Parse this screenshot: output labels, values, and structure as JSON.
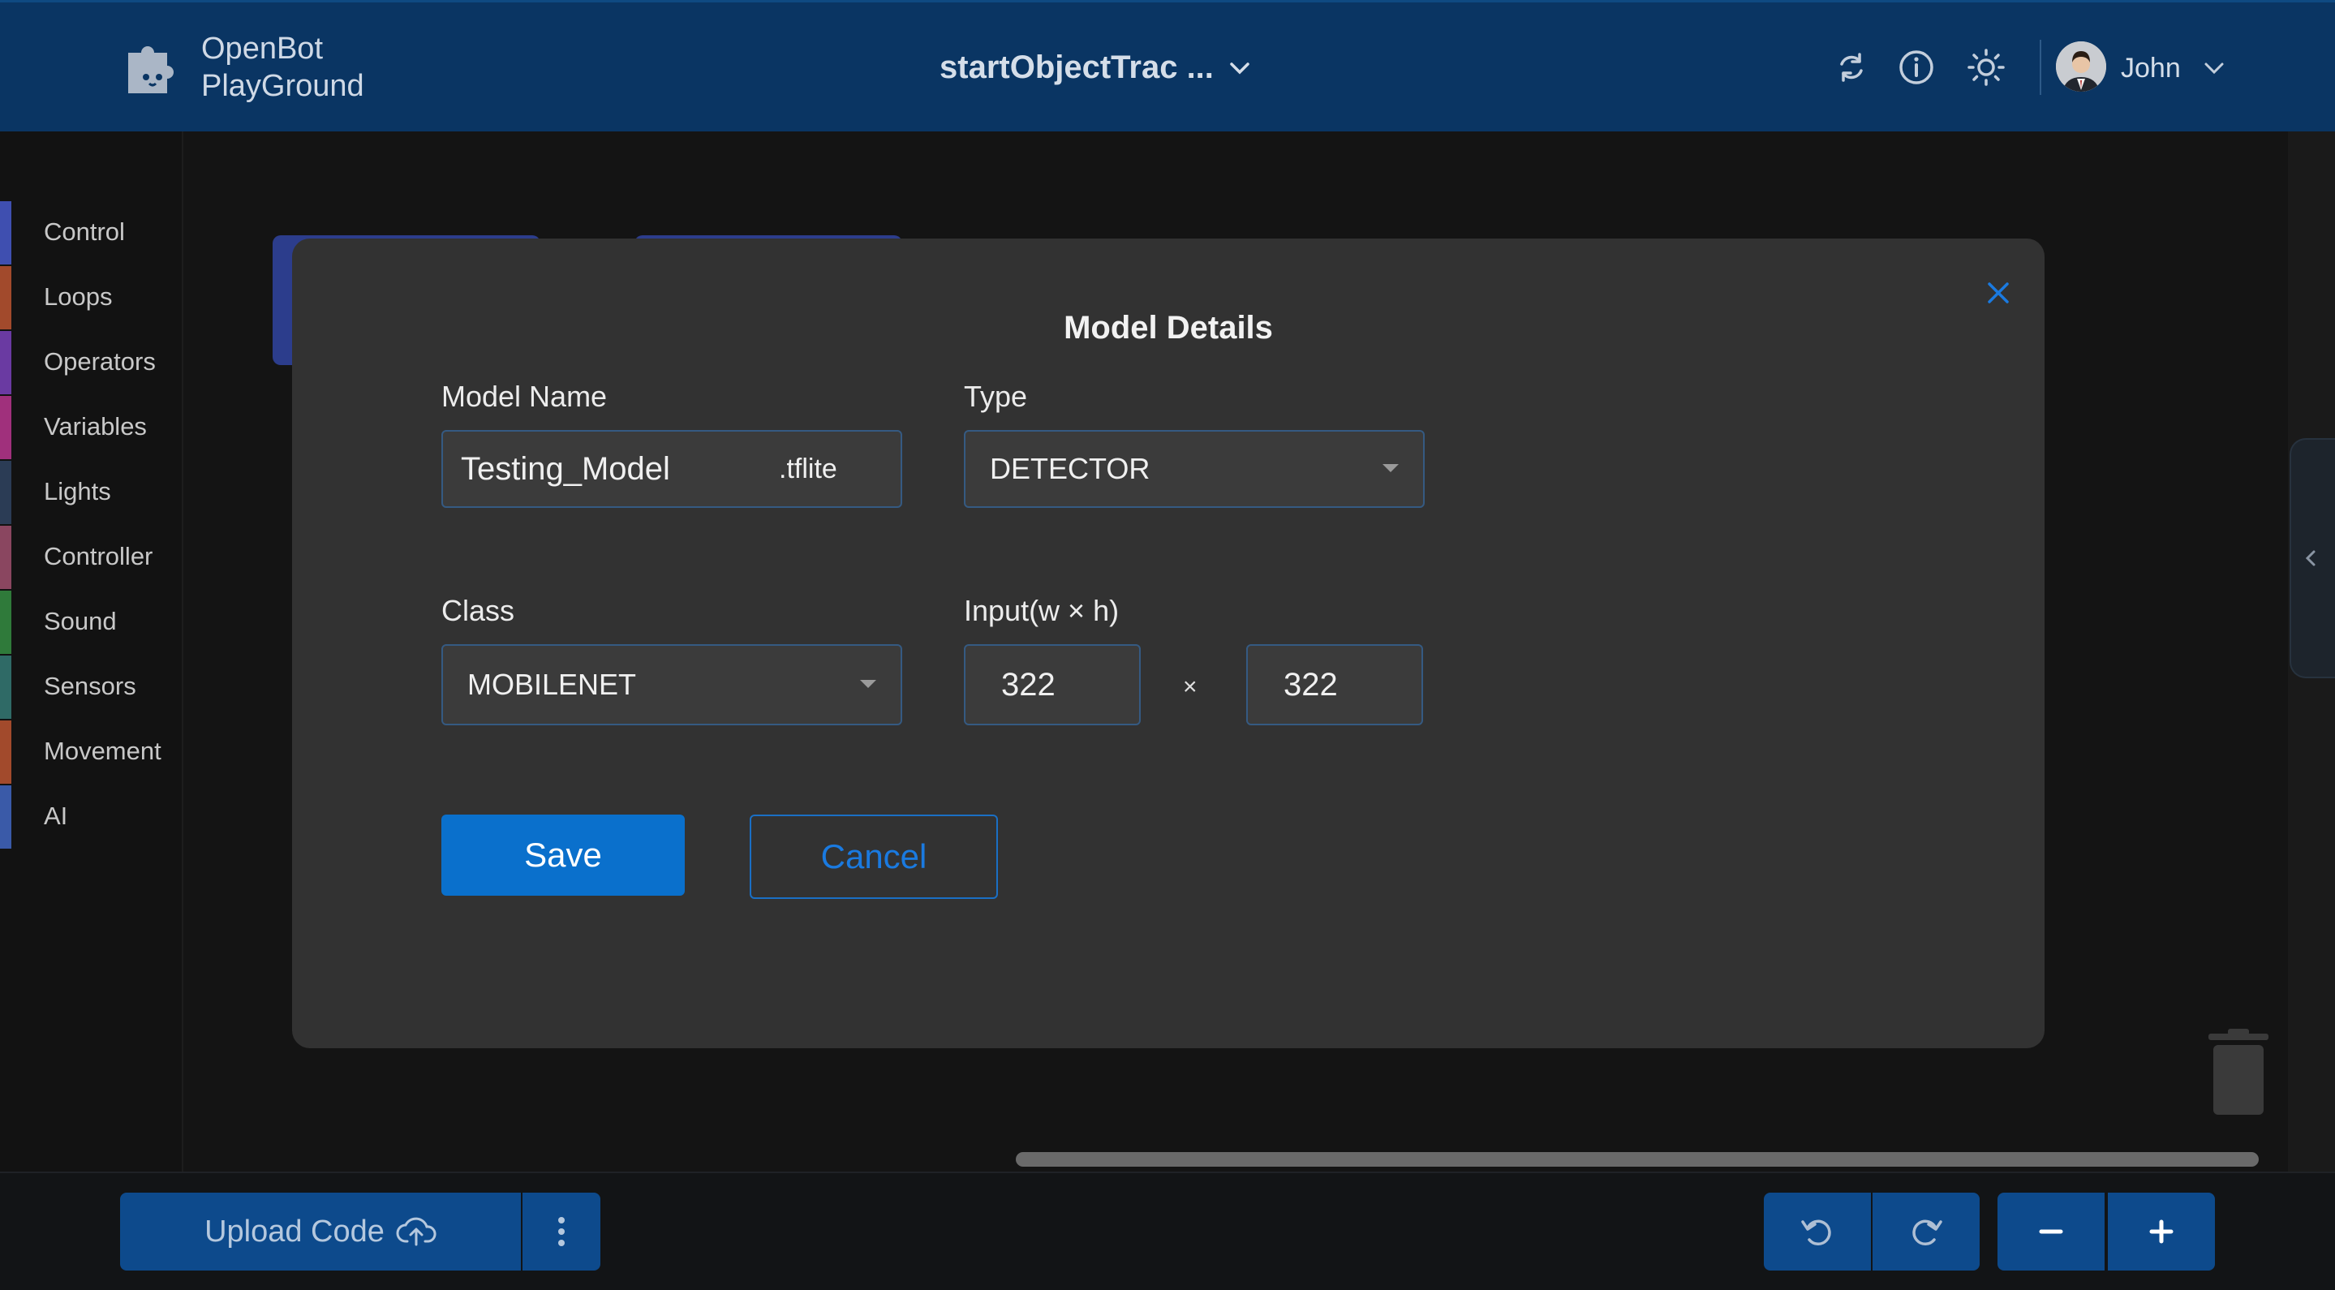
{
  "header": {
    "brand_line1": "OpenBot",
    "brand_line2": "PlayGround",
    "project_name": "startObjectTrac ...",
    "user_name": "John",
    "icons": [
      "puzzle-logo-icon",
      "sync-icon",
      "info-icon",
      "sun-icon",
      "user-avatar",
      "chevron-down-icon"
    ]
  },
  "sidebar": {
    "categories": [
      {
        "label": "Control",
        "color": "#3f4fb0"
      },
      {
        "label": "Loops",
        "color": "#a24a2c"
      },
      {
        "label": "Operators",
        "color": "#6a3aa2"
      },
      {
        "label": "Variables",
        "color": "#a0307c"
      },
      {
        "label": "Lights",
        "color": "#2b3c55"
      },
      {
        "label": "Controller",
        "color": "#8a4660"
      },
      {
        "label": "Sound",
        "color": "#2f7a3a"
      },
      {
        "label": "Sensors",
        "color": "#2f6a66"
      },
      {
        "label": "Movement",
        "color": "#a24a2c"
      },
      {
        "label": "AI",
        "color": "#3a5aa8"
      }
    ]
  },
  "modal": {
    "title": "Model Details",
    "model_name_label": "Model Name",
    "model_name_value": "Testing_Model",
    "model_name_suffix": ".tflite",
    "type_label": "Type",
    "type_value": "DETECTOR",
    "class_label": "Class",
    "class_value": "MOBILENET",
    "input_label": "Input(w × h)",
    "input_width": "322",
    "input_height": "322",
    "times_sign": "×",
    "save_label": "Save",
    "cancel_label": "Cancel"
  },
  "bottom_bar": {
    "upload_label": "Upload Code",
    "icons": [
      "upload-cloud-icon",
      "more-vertical-icon",
      "undo-icon",
      "redo-icon",
      "zoom-out-icon",
      "zoom-in-icon"
    ]
  },
  "colors": {
    "header_bg": "#0a3563",
    "accent_blue": "#0a70cc",
    "modal_bg": "#323232"
  }
}
